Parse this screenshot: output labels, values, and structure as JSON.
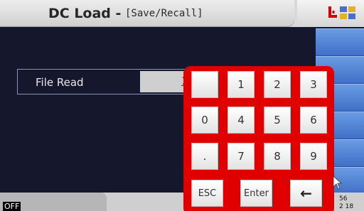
{
  "titlebar": {
    "title": "DC Load -",
    "subtitle": "[Save/Recall]"
  },
  "file_read": {
    "label": "File Read",
    "value": "1"
  },
  "keypad": {
    "row1": [
      "",
      "1",
      "2",
      "3"
    ],
    "row2": [
      "0",
      "4",
      "5",
      "6"
    ],
    "row3": [
      ".",
      "7",
      "8",
      "9"
    ],
    "esc_label": "ESC",
    "enter_label": "Enter",
    "back_label": "←"
  },
  "status": {
    "output": "OFF",
    "clock_line1": "56",
    "clock_line2": "2 18"
  },
  "colors": {
    "keypad": "#e00000",
    "softkey": "#4a7fd6",
    "background": "#15172d"
  }
}
